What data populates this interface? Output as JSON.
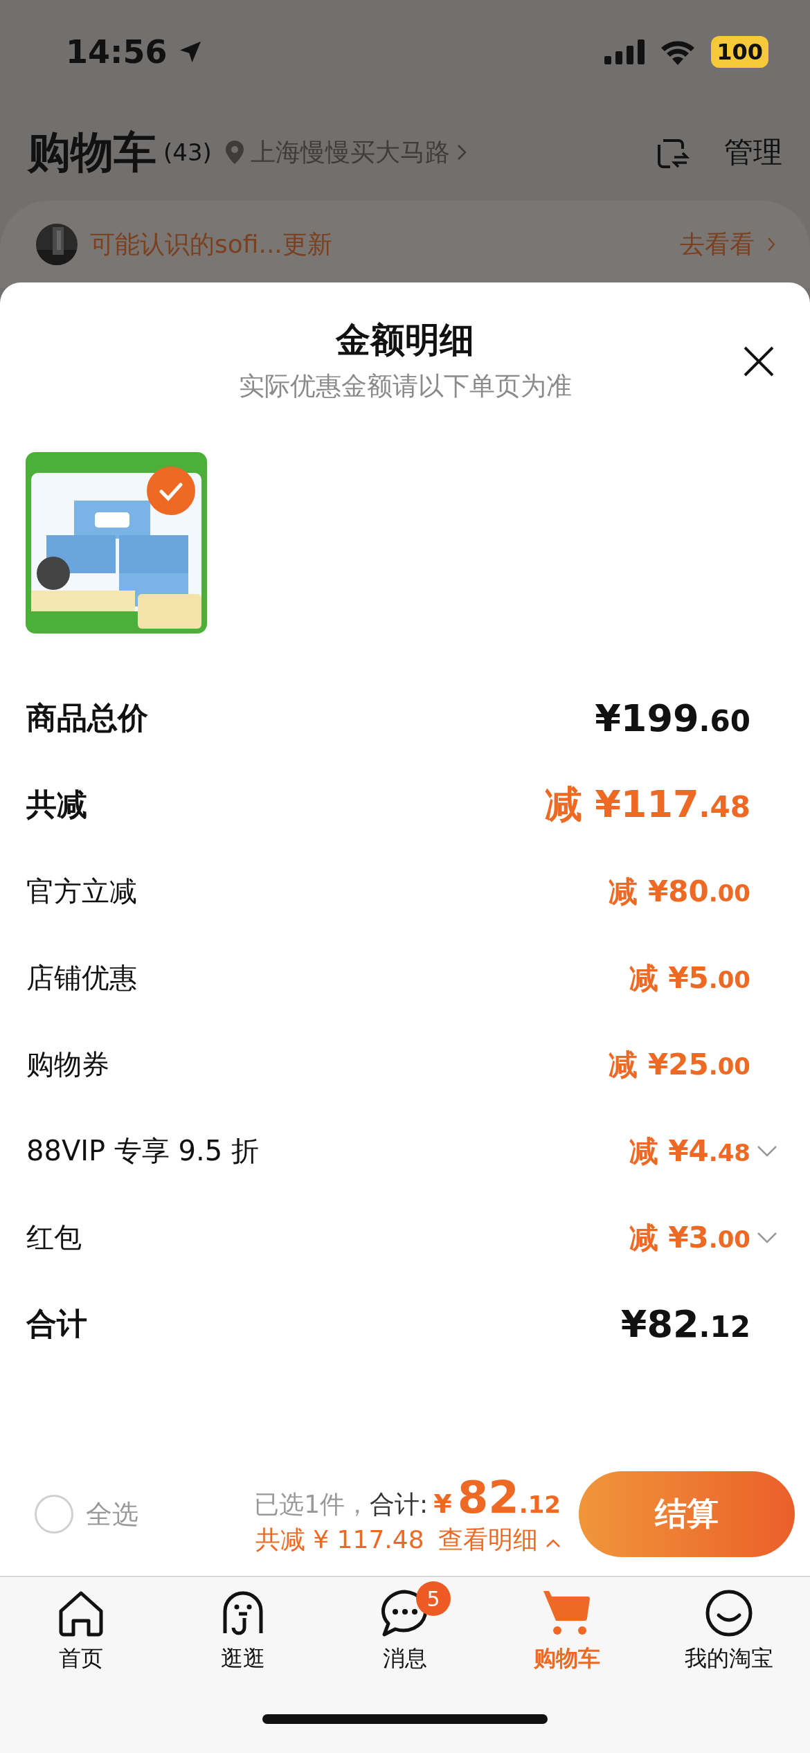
{
  "status_bar": {
    "time": "14:56",
    "battery": "100"
  },
  "header": {
    "title": "购物车",
    "count": "(43)",
    "location": "上海慢慢买大马路",
    "manage": "管理"
  },
  "banner": {
    "text": "可能认识的sofi...更新",
    "action": "去看看"
  },
  "sheet": {
    "title": "金额明细",
    "subtitle": "实际优惠金额请以下单页为准",
    "product": {
      "kind": "picture",
      "selected": true
    },
    "rows": [
      {
        "label": "商品总价",
        "value": "¥199.60",
        "bold": true,
        "discount": false,
        "expandable": false
      },
      {
        "label": "共减",
        "value": "减 ¥117.48",
        "bold": true,
        "discount": true,
        "expandable": false
      },
      {
        "label": "官方立减",
        "value": "减 ¥80.00",
        "bold": false,
        "discount": true,
        "expandable": false
      },
      {
        "label": "店铺优惠",
        "value": "减 ¥5.00",
        "bold": false,
        "discount": true,
        "expandable": false
      },
      {
        "label": "购物券",
        "value": "减 ¥25.00",
        "bold": false,
        "discount": true,
        "expandable": false
      },
      {
        "label": "88VIP 专享 9.5 折",
        "value": "减 ¥4.48",
        "bold": false,
        "discount": true,
        "expandable": true
      },
      {
        "label": "红包",
        "value": "减 ¥3.00",
        "bold": false,
        "discount": true,
        "expandable": true
      },
      {
        "label": "合计",
        "value": "¥82.12",
        "bold": true,
        "discount": false,
        "expandable": false
      }
    ]
  },
  "checkout": {
    "select_all": {
      "label": "全选",
      "checked": false
    },
    "selected_count": "已选1件，",
    "total_label": "合计:",
    "total": "¥82.12",
    "saved": "共减 ¥ 117.48",
    "detail_link": "查看明细",
    "button": "结算"
  },
  "tabs": [
    {
      "label": "首页",
      "kind": "home",
      "selected": false
    },
    {
      "label": "逛逛",
      "kind": "explore",
      "selected": false
    },
    {
      "label": "消息",
      "kind": "chat",
      "selected": false,
      "badge": "5"
    },
    {
      "label": "购物车",
      "kind": "cart",
      "selected": true
    },
    {
      "label": "我的淘宝",
      "kind": "face",
      "selected": false
    }
  ]
}
